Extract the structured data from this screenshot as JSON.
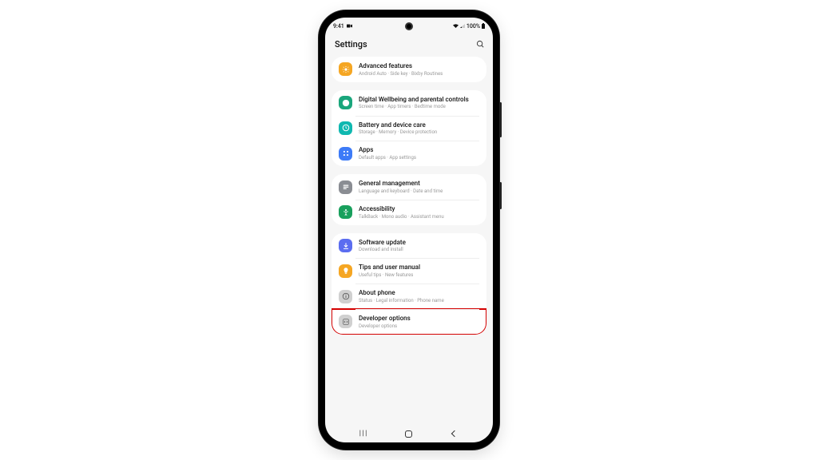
{
  "status": {
    "time": "9:41",
    "battery": "100%"
  },
  "header": {
    "title": "Settings"
  },
  "groups": [
    {
      "rows": [
        {
          "icon": "advanced",
          "color": "#f5a623",
          "title": "Advanced features",
          "sub": "Android Auto · Side key · Bixby Routines"
        }
      ]
    },
    {
      "rows": [
        {
          "icon": "wellbeing",
          "color": "#1aa67c",
          "title": "Digital Wellbeing and parental controls",
          "sub": "Screen time · App timers · Bedtime mode"
        },
        {
          "icon": "battery",
          "color": "#0fb8b0",
          "title": "Battery and device care",
          "sub": "Storage · Memory · Device protection"
        },
        {
          "icon": "apps",
          "color": "#3d7bf7",
          "title": "Apps",
          "sub": "Default apps · App settings"
        }
      ]
    },
    {
      "rows": [
        {
          "icon": "general",
          "color": "#8a8d93",
          "title": "General management",
          "sub": "Language and keyboard · Date and time"
        },
        {
          "icon": "accessibility",
          "color": "#19a05d",
          "title": "Accessibility",
          "sub": "TalkBack · Mono audio · Assistant menu"
        }
      ]
    },
    {
      "rows": [
        {
          "icon": "update",
          "color": "#5b6df0",
          "title": "Software update",
          "sub": "Download and install"
        },
        {
          "icon": "tips",
          "color": "#f5a623",
          "title": "Tips and user manual",
          "sub": "Useful tips · New features"
        },
        {
          "icon": "about",
          "color": "#d0d0d0",
          "title": "About phone",
          "sub": "Status · Legal information · Phone name"
        },
        {
          "icon": "developer",
          "color": "#d0d0d0",
          "title": "Developer options",
          "sub": "Developer options",
          "highlight": true
        }
      ]
    }
  ]
}
